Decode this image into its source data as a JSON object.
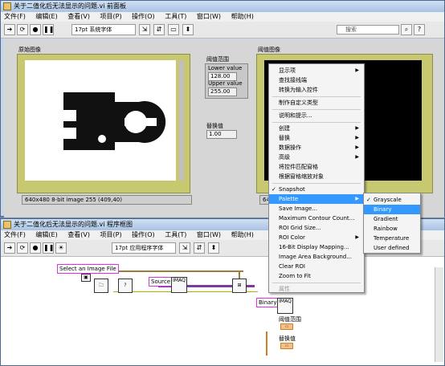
{
  "front_panel": {
    "title": "关于二值化后无法显示的问题.vi 前面板",
    "menus": [
      "文件(F)",
      "编辑(E)",
      "查看(V)",
      "项目(P)",
      "操作(O)",
      "工具(T)",
      "窗口(W)",
      "帮助(H)"
    ],
    "font_selector": "17pt 系统字体",
    "search_placeholder": "搜索",
    "original_label": "原始图像",
    "binary_label": "阈值图像",
    "threshold_range_label": "阈值范围",
    "lower_label": "Lower value",
    "lower_value": "128.00",
    "upper_label": "Upper value",
    "upper_value": "255.00",
    "replace_label": "替换值",
    "replace_value": "1.00",
    "status_left": "640x480 8-bit image 255     (409,40)",
    "status_right": "640x"
  },
  "block_diagram": {
    "title": "关于二值化后无法显示的问题.vi 程序框图",
    "menus": [
      "文件(F)",
      "编辑(E)",
      "查看(V)",
      "项目(P)",
      "操作(O)",
      "工具(T)",
      "窗口(W)",
      "帮助(H)"
    ],
    "font_selector": "17pt 应用程序字体",
    "select_file_label": "Select an Image File",
    "source_label": "Source",
    "binary_const": "Binary",
    "imaq_label": "IMAQ",
    "threshold_node_label": "阈值范围",
    "replace_node_label": "替换值"
  },
  "context_menu": {
    "items": [
      "显示项",
      "查找接线端",
      "转换为输入控件",
      "制作自定义类型",
      "说明和提示...",
      "创建",
      "替换",
      "数据操作",
      "高级",
      "将控件匹配窗格",
      "根据窗格缩放对象",
      "Snapshot",
      "Palette",
      "Save Image...",
      "Maximum Contour Count...",
      "ROI Grid Size...",
      "ROI Color",
      "16-Bit Display Mapping...",
      "Image Area Background...",
      "Clear ROI",
      "Zoom to Fit",
      "属性"
    ]
  },
  "palette_submenu": {
    "items": [
      "Grayscale",
      "Binary",
      "Gradient",
      "Rainbow",
      "Temperature",
      "User defined"
    ]
  }
}
